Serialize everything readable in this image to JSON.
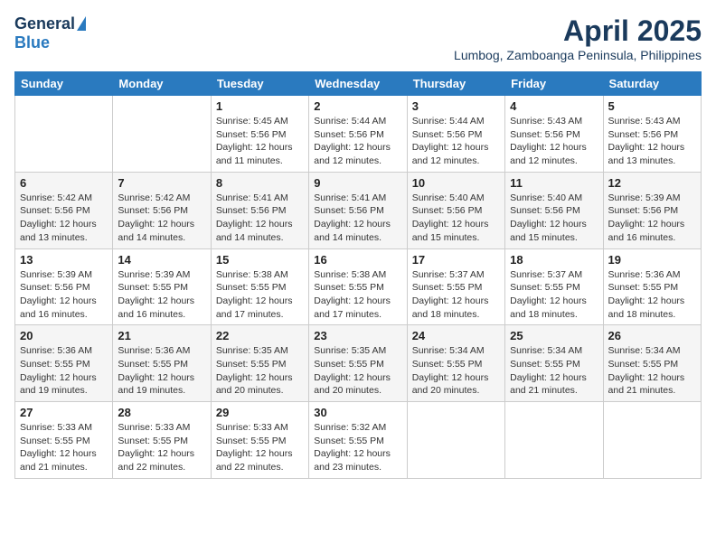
{
  "logo": {
    "general": "General",
    "blue": "Blue"
  },
  "header": {
    "title": "April 2025",
    "subtitle": "Lumbog, Zamboanga Peninsula, Philippines"
  },
  "days_of_week": [
    "Sunday",
    "Monday",
    "Tuesday",
    "Wednesday",
    "Thursday",
    "Friday",
    "Saturday"
  ],
  "weeks": [
    [
      {
        "day": "",
        "info": ""
      },
      {
        "day": "",
        "info": ""
      },
      {
        "day": "1",
        "info": "Sunrise: 5:45 AM\nSunset: 5:56 PM\nDaylight: 12 hours and 11 minutes."
      },
      {
        "day": "2",
        "info": "Sunrise: 5:44 AM\nSunset: 5:56 PM\nDaylight: 12 hours and 12 minutes."
      },
      {
        "day": "3",
        "info": "Sunrise: 5:44 AM\nSunset: 5:56 PM\nDaylight: 12 hours and 12 minutes."
      },
      {
        "day": "4",
        "info": "Sunrise: 5:43 AM\nSunset: 5:56 PM\nDaylight: 12 hours and 12 minutes."
      },
      {
        "day": "5",
        "info": "Sunrise: 5:43 AM\nSunset: 5:56 PM\nDaylight: 12 hours and 13 minutes."
      }
    ],
    [
      {
        "day": "6",
        "info": "Sunrise: 5:42 AM\nSunset: 5:56 PM\nDaylight: 12 hours and 13 minutes."
      },
      {
        "day": "7",
        "info": "Sunrise: 5:42 AM\nSunset: 5:56 PM\nDaylight: 12 hours and 14 minutes."
      },
      {
        "day": "8",
        "info": "Sunrise: 5:41 AM\nSunset: 5:56 PM\nDaylight: 12 hours and 14 minutes."
      },
      {
        "day": "9",
        "info": "Sunrise: 5:41 AM\nSunset: 5:56 PM\nDaylight: 12 hours and 14 minutes."
      },
      {
        "day": "10",
        "info": "Sunrise: 5:40 AM\nSunset: 5:56 PM\nDaylight: 12 hours and 15 minutes."
      },
      {
        "day": "11",
        "info": "Sunrise: 5:40 AM\nSunset: 5:56 PM\nDaylight: 12 hours and 15 minutes."
      },
      {
        "day": "12",
        "info": "Sunrise: 5:39 AM\nSunset: 5:56 PM\nDaylight: 12 hours and 16 minutes."
      }
    ],
    [
      {
        "day": "13",
        "info": "Sunrise: 5:39 AM\nSunset: 5:56 PM\nDaylight: 12 hours and 16 minutes."
      },
      {
        "day": "14",
        "info": "Sunrise: 5:39 AM\nSunset: 5:55 PM\nDaylight: 12 hours and 16 minutes."
      },
      {
        "day": "15",
        "info": "Sunrise: 5:38 AM\nSunset: 5:55 PM\nDaylight: 12 hours and 17 minutes."
      },
      {
        "day": "16",
        "info": "Sunrise: 5:38 AM\nSunset: 5:55 PM\nDaylight: 12 hours and 17 minutes."
      },
      {
        "day": "17",
        "info": "Sunrise: 5:37 AM\nSunset: 5:55 PM\nDaylight: 12 hours and 18 minutes."
      },
      {
        "day": "18",
        "info": "Sunrise: 5:37 AM\nSunset: 5:55 PM\nDaylight: 12 hours and 18 minutes."
      },
      {
        "day": "19",
        "info": "Sunrise: 5:36 AM\nSunset: 5:55 PM\nDaylight: 12 hours and 18 minutes."
      }
    ],
    [
      {
        "day": "20",
        "info": "Sunrise: 5:36 AM\nSunset: 5:55 PM\nDaylight: 12 hours and 19 minutes."
      },
      {
        "day": "21",
        "info": "Sunrise: 5:36 AM\nSunset: 5:55 PM\nDaylight: 12 hours and 19 minutes."
      },
      {
        "day": "22",
        "info": "Sunrise: 5:35 AM\nSunset: 5:55 PM\nDaylight: 12 hours and 20 minutes."
      },
      {
        "day": "23",
        "info": "Sunrise: 5:35 AM\nSunset: 5:55 PM\nDaylight: 12 hours and 20 minutes."
      },
      {
        "day": "24",
        "info": "Sunrise: 5:34 AM\nSunset: 5:55 PM\nDaylight: 12 hours and 20 minutes."
      },
      {
        "day": "25",
        "info": "Sunrise: 5:34 AM\nSunset: 5:55 PM\nDaylight: 12 hours and 21 minutes."
      },
      {
        "day": "26",
        "info": "Sunrise: 5:34 AM\nSunset: 5:55 PM\nDaylight: 12 hours and 21 minutes."
      }
    ],
    [
      {
        "day": "27",
        "info": "Sunrise: 5:33 AM\nSunset: 5:55 PM\nDaylight: 12 hours and 21 minutes."
      },
      {
        "day": "28",
        "info": "Sunrise: 5:33 AM\nSunset: 5:55 PM\nDaylight: 12 hours and 22 minutes."
      },
      {
        "day": "29",
        "info": "Sunrise: 5:33 AM\nSunset: 5:55 PM\nDaylight: 12 hours and 22 minutes."
      },
      {
        "day": "30",
        "info": "Sunrise: 5:32 AM\nSunset: 5:55 PM\nDaylight: 12 hours and 23 minutes."
      },
      {
        "day": "",
        "info": ""
      },
      {
        "day": "",
        "info": ""
      },
      {
        "day": "",
        "info": ""
      }
    ]
  ]
}
